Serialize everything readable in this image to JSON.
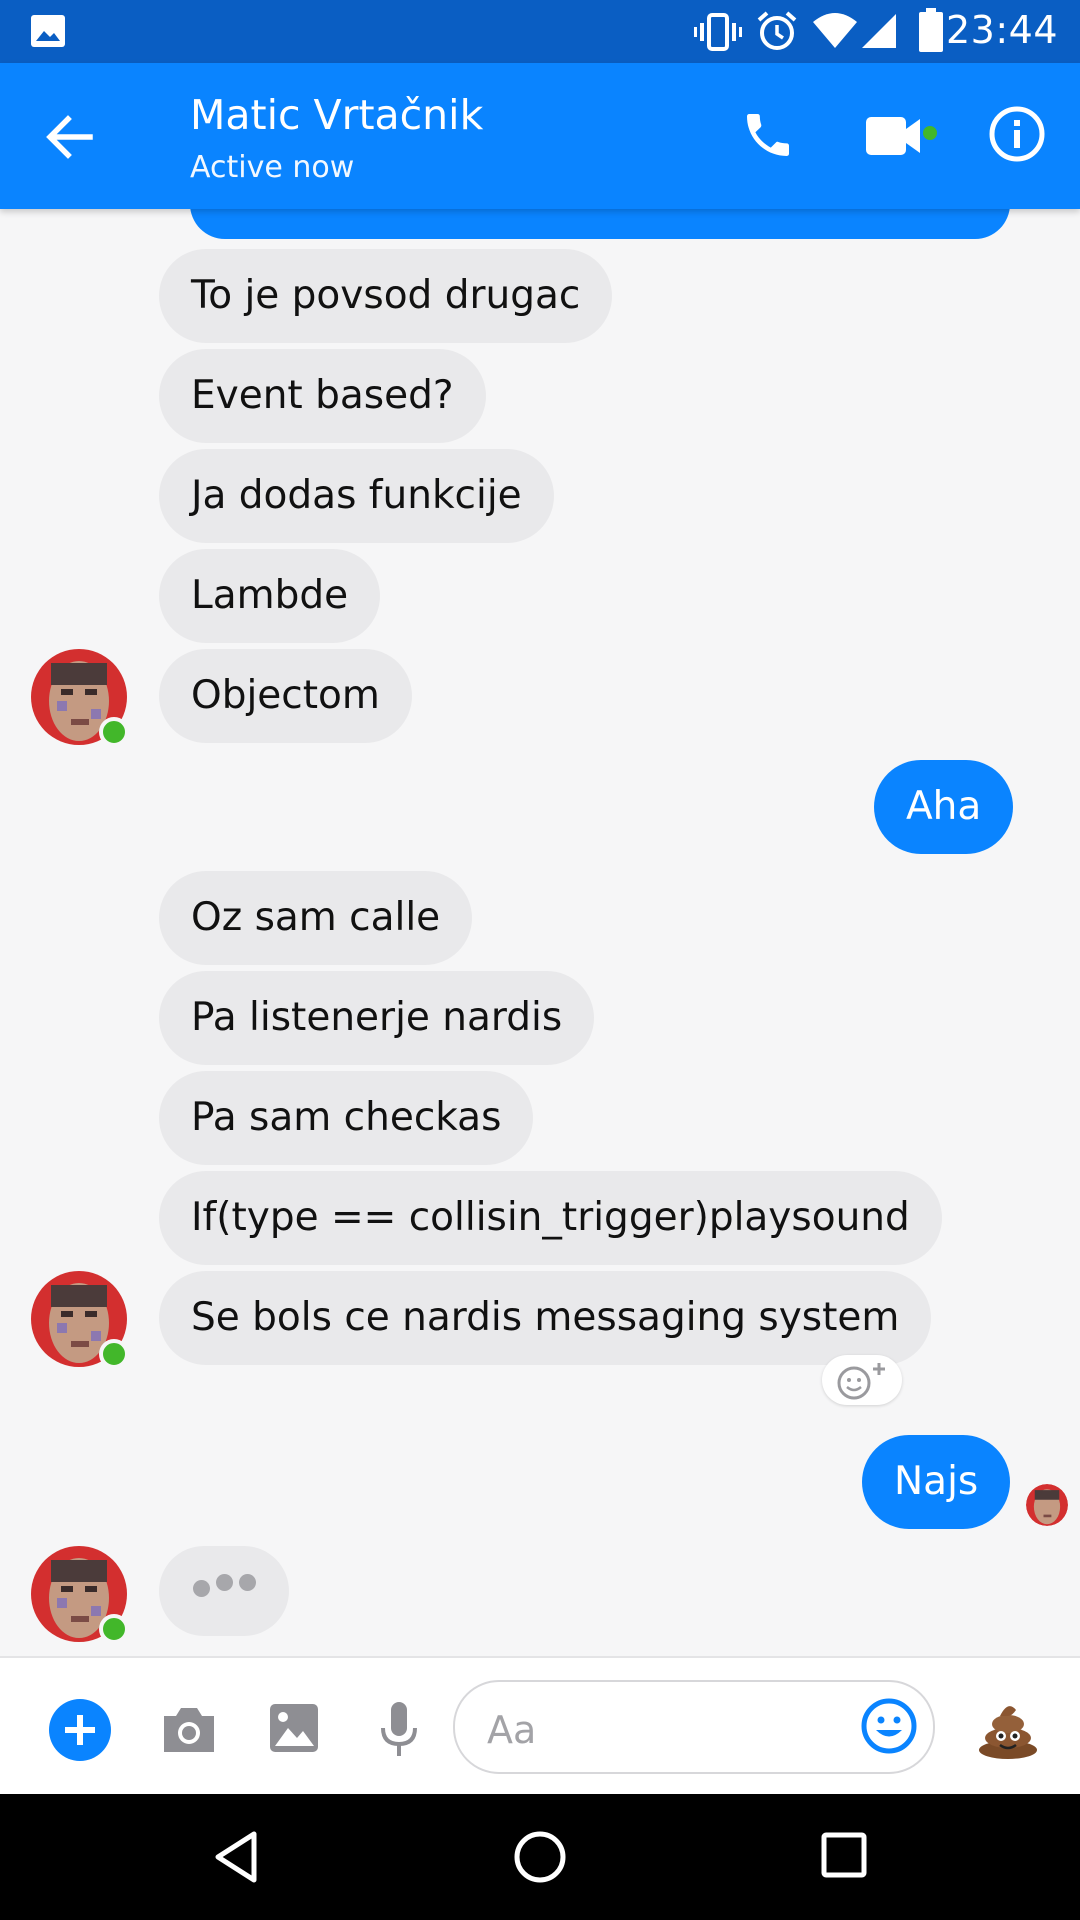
{
  "status_bar": {
    "time": "23:44",
    "icons": [
      "image-icon",
      "vibrate-icon",
      "alarm-icon",
      "wifi-icon",
      "signal-icon",
      "battery-icon"
    ]
  },
  "header": {
    "contact_name": "Matic Vrtačnik",
    "status": "Active now",
    "icons": [
      "back-arrow-icon",
      "phone-icon",
      "video-camera-icon",
      "info-icon"
    ]
  },
  "messages": [
    {
      "from": "them",
      "text": "To je povsod drugac"
    },
    {
      "from": "them",
      "text": "Event based?"
    },
    {
      "from": "them",
      "text": "Ja dodas funkcije"
    },
    {
      "from": "them",
      "text": "Lambde"
    },
    {
      "from": "them",
      "text": "Objectom"
    },
    {
      "from": "me",
      "text": "Aha"
    },
    {
      "from": "them",
      "text": "Oz sam calle"
    },
    {
      "from": "them",
      "text": "Pa listenerje nardis"
    },
    {
      "from": "them",
      "text": "Pa sam checkas"
    },
    {
      "from": "them",
      "text": "If(type == collisin_trigger)playsound"
    },
    {
      "from": "them",
      "text": "Se bols ce nardis messaging system"
    },
    {
      "from": "me",
      "text": "Najs"
    }
  ],
  "composer": {
    "placeholder": "Aa",
    "icons": [
      "plus-icon",
      "camera-icon",
      "gallery-icon",
      "microphone-icon",
      "emoji-icon",
      "poop-emoji-icon"
    ]
  },
  "colors": {
    "status_bar": "#0a5ec3",
    "header": "#0a84ff",
    "outgoing_bubble": "#0a84ff",
    "incoming_bubble": "#e9e9eb",
    "online_dot": "#42b72a"
  },
  "nav_bar": {
    "icons": [
      "back-triangle-icon",
      "home-circle-icon",
      "recents-square-icon"
    ]
  }
}
